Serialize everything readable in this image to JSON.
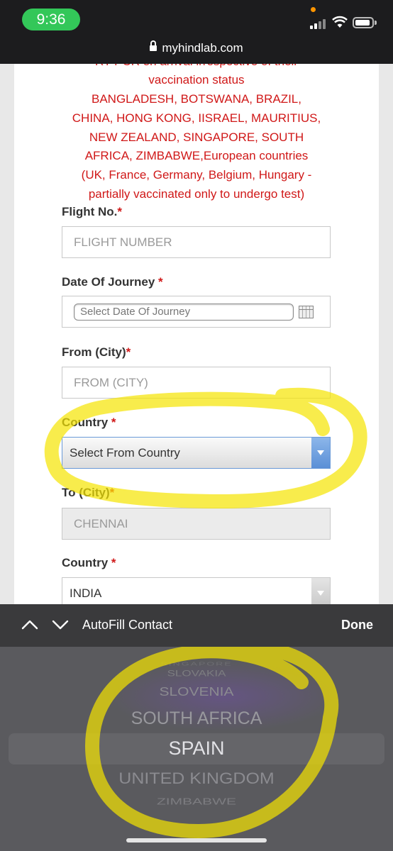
{
  "status_bar": {
    "time": "9:36"
  },
  "url_bar": {
    "domain": "myhindlab.com"
  },
  "notice": {
    "lines": [
      "RT-PCR on arrival irrespective of their",
      "vaccination status",
      "BANGLADESH, BOTSWANA, BRAZIL,",
      "CHINA, HONG KONG, IISRAEL, MAURITIUS,",
      "NEW ZEALAND, SINGAPORE, SOUTH",
      "AFRICA, ZIMBABWE,European countries",
      "(UK, France, Germany, Belgium, Hungary -",
      "partially vaccinated only to undergo test)"
    ]
  },
  "form": {
    "flight_no": {
      "label": "Flight No.",
      "required": "*",
      "placeholder": "FLIGHT NUMBER"
    },
    "date_of_journey": {
      "label": "Date Of Journey ",
      "required": "*",
      "placeholder": "Select Date Of Journey"
    },
    "from_city": {
      "label": "From (City)",
      "required": "*",
      "placeholder": "FROM (CITY)"
    },
    "from_country": {
      "label": "Country ",
      "required": "*",
      "selected": "Select From Country"
    },
    "to_city": {
      "label": "To (City)",
      "required": "*",
      "value": "CHENNAI"
    },
    "to_country": {
      "label": "Country ",
      "required": "*",
      "selected": "INDIA"
    }
  },
  "keyboard_toolbar": {
    "autofill_label": "AutoFill Contact",
    "done_label": "Done"
  },
  "picker": {
    "options": [
      "SINGAPORE",
      "SLOVAKIA",
      "SLOVENIA",
      "SOUTH AFRICA",
      "SPAIN",
      "UNITED KINGDOM",
      "ZIMBABWE"
    ],
    "selected": "SPAIN"
  },
  "colors": {
    "required_red": "#d01818",
    "highlighter": "#f5e400",
    "select_arrow_blue": "#5a8fd6",
    "time_pill_green": "#33c759"
  }
}
